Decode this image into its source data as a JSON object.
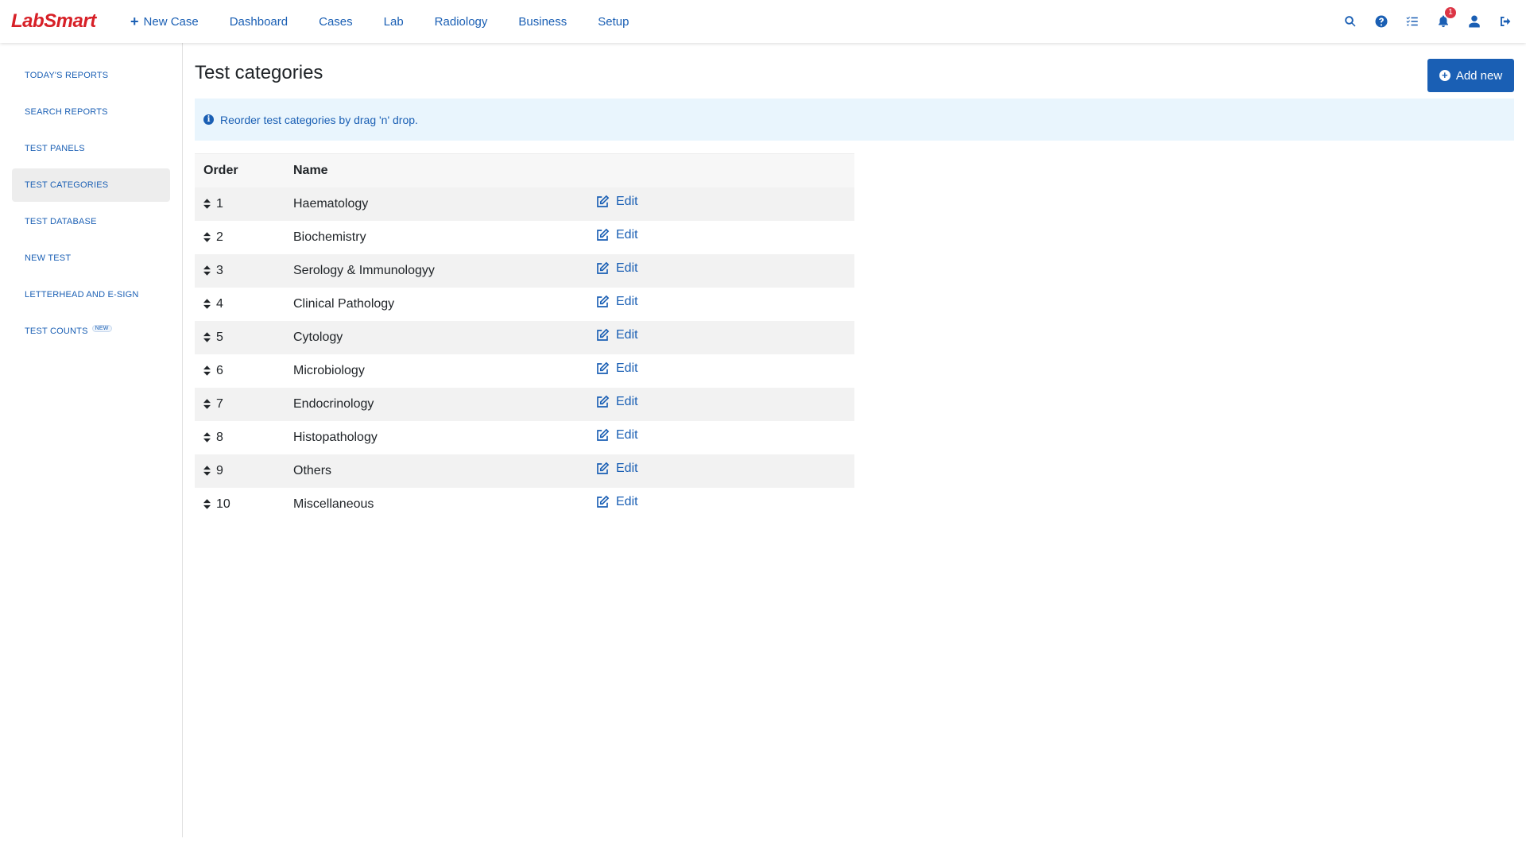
{
  "brand": {
    "logo_text": "LabSmart"
  },
  "nav": {
    "new_case": "New Case",
    "items": [
      "Dashboard",
      "Cases",
      "Lab",
      "Radiology",
      "Business",
      "Setup"
    ]
  },
  "header_icons": {
    "notifications_count": "1"
  },
  "sidebar": {
    "items": [
      {
        "label": "Today's Reports"
      },
      {
        "label": "Search Reports"
      },
      {
        "label": "Test Panels"
      },
      {
        "label": "Test Categories"
      },
      {
        "label": "Test Database"
      },
      {
        "label": "New Test"
      },
      {
        "label": "Letterhead and E-sign"
      },
      {
        "label": "Test Counts",
        "tag": "NEW"
      }
    ],
    "active_index": 3
  },
  "page": {
    "title": "Test categories",
    "add_button": "Add new",
    "info_text": "Reorder test categories by drag 'n' drop."
  },
  "table": {
    "headers": [
      "Order",
      "Name",
      ""
    ],
    "edit_label": "Edit",
    "rows": [
      {
        "order": "1",
        "name": "Haematology"
      },
      {
        "order": "2",
        "name": "Biochemistry"
      },
      {
        "order": "3",
        "name": "Serology & Immunologyy"
      },
      {
        "order": "4",
        "name": "Clinical Pathology"
      },
      {
        "order": "5",
        "name": "Cytology"
      },
      {
        "order": "6",
        "name": "Microbiology"
      },
      {
        "order": "7",
        "name": "Endocrinology"
      },
      {
        "order": "8",
        "name": "Histopathology"
      },
      {
        "order": "9",
        "name": "Others"
      },
      {
        "order": "10",
        "name": "Miscellaneous"
      }
    ]
  },
  "colors": {
    "accent": "#1a5fb4",
    "brand": "#d72027",
    "badge": "#dc3545",
    "info_bg": "#e9f5fd"
  }
}
